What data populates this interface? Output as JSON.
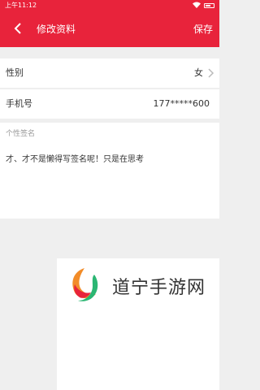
{
  "status_bar": {
    "time": "上午11:12"
  },
  "header": {
    "title": "修改资料",
    "save_label": "保存"
  },
  "profile": {
    "gender_label": "性别",
    "gender_value": "女",
    "phone_label": "手机号",
    "phone_value": "177*****600",
    "signature_label": "个性签名",
    "signature_text": "才、才不是懒得写签名呢！只是在思考"
  },
  "watermark": {
    "text": "道宁手游网"
  },
  "colors": {
    "accent": "#e8233b",
    "background": "#efefef"
  },
  "icons": {
    "back": "chevron-left-icon",
    "row_arrow": "chevron-right-icon",
    "wifi": "wifi-icon",
    "battery": "battery-icon"
  }
}
